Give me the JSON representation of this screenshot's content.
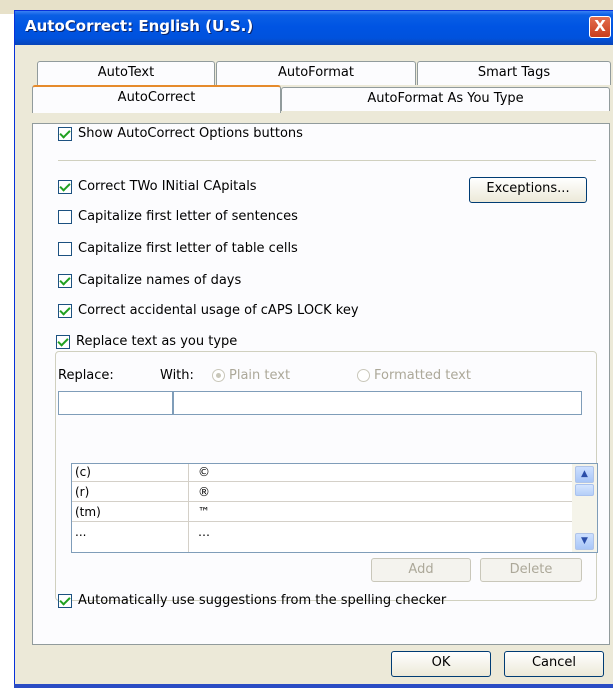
{
  "dialog": {
    "title": "AutoCorrect: English (U.S.)",
    "close_label": "X"
  },
  "tabs": {
    "row1": [
      "AutoText",
      "AutoFormat",
      "Smart Tags"
    ],
    "row2": [
      "AutoCorrect",
      "AutoFormat As You Type"
    ],
    "active": "AutoCorrect"
  },
  "options": {
    "show_buttons": "Show AutoCorrect Options buttons",
    "two_initial": "Correct TWo INitial CApitals",
    "first_letter_sentences": "Capitalize first letter of sentences",
    "first_letter_table": "Capitalize first letter of table cells",
    "names_of_days": "Capitalize names of days",
    "caps_lock": "Correct accidental usage of cAPS LOCK key",
    "replace_text": "Replace text as you type",
    "auto_suggestions": "Automatically use suggestions from the spelling checker"
  },
  "checked": {
    "show_buttons": true,
    "two_initial": true,
    "first_letter_sentences": false,
    "first_letter_table": false,
    "names_of_days": true,
    "caps_lock": true,
    "replace_text": true,
    "auto_suggestions": true
  },
  "buttons": {
    "exceptions": "Exceptions...",
    "add": "Add",
    "delete": "Delete",
    "ok": "OK",
    "cancel": "Cancel"
  },
  "replace": {
    "replace_label": "Replace:",
    "with_label": "With:",
    "plain_text": "Plain text",
    "formatted_text": "Formatted text",
    "replace_value": "",
    "with_value": ""
  },
  "entries": [
    {
      "replace": "(c)",
      "with": "©"
    },
    {
      "replace": "(r)",
      "with": "®"
    },
    {
      "replace": "(tm)",
      "with": "™"
    },
    {
      "replace": "...",
      "with": "…"
    }
  ]
}
